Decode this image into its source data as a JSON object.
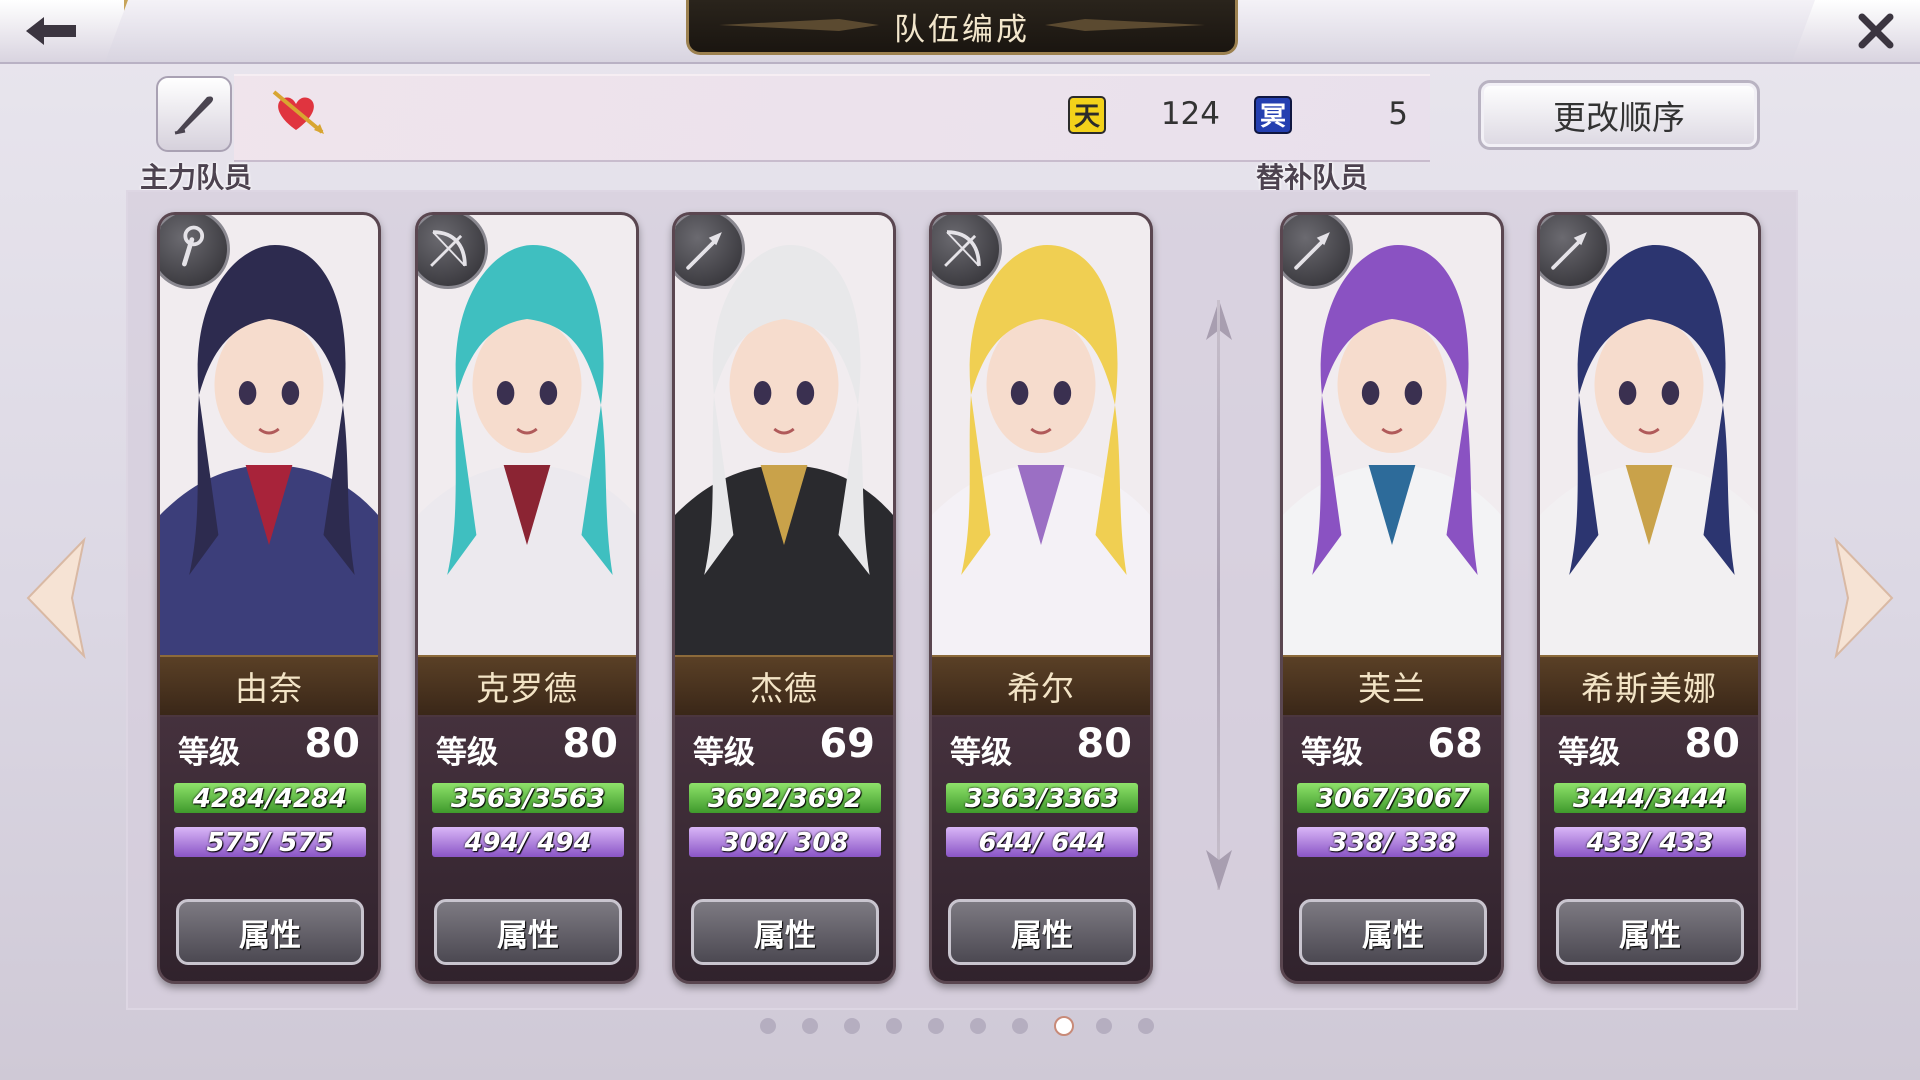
{
  "header": {
    "title": "队伍编成"
  },
  "resources": {
    "heaven_icon_label": "天",
    "heaven_value": "124",
    "hell_icon_label": "冥",
    "hell_value": "5"
  },
  "buttons": {
    "reorder": "更改顺序",
    "attribute": "属性"
  },
  "sections": {
    "main": "主力队员",
    "reserve": "替补队员"
  },
  "labels": {
    "level": "等级"
  },
  "members": [
    {
      "name": "由奈",
      "level": "80",
      "hp": "4284/4284",
      "mp": "575/ 575",
      "class_icon": "staff-icon",
      "hair": "#2d2b4f",
      "outfit": "#3c3e7a",
      "accent": "#a8233a"
    },
    {
      "name": "克罗德",
      "level": "80",
      "hp": "3563/3563",
      "mp": "494/ 494",
      "class_icon": "bow-icon",
      "hair": "#3fbfc0",
      "outfit": "#ece9ee",
      "accent": "#8b2433"
    },
    {
      "name": "杰德",
      "level": "69",
      "hp": "3692/3692",
      "mp": "308/ 308",
      "class_icon": "spear-icon",
      "hair": "#e8e8ea",
      "outfit": "#2a2a2e",
      "accent": "#c9a24a"
    },
    {
      "name": "希尔",
      "level": "80",
      "hp": "3363/3363",
      "mp": "644/ 644",
      "class_icon": "bow-icon",
      "hair": "#f0cf52",
      "outfit": "#f4f1f6",
      "accent": "#9b6fc4"
    },
    {
      "name": "芙兰",
      "level": "68",
      "hp": "3067/3067",
      "mp": "338/ 338",
      "class_icon": "spear-icon",
      "hair": "#8a52c2",
      "outfit": "#f3f3f5",
      "accent": "#2d6b9a"
    },
    {
      "name": "希斯美娜",
      "level": "80",
      "hp": "3444/3444",
      "mp": "433/ 433",
      "class_icon": "spear-icon",
      "hair": "#2c3570",
      "outfit": "#f2f0f2",
      "accent": "#c9a24a"
    }
  ],
  "pagination": {
    "total": 10,
    "current": 8
  },
  "colors": {
    "hp_bar": "#6cc84a",
    "mp_bar": "#b688e4",
    "nameplate": "#4a3320",
    "active_dot_ring": "#c88a78"
  }
}
